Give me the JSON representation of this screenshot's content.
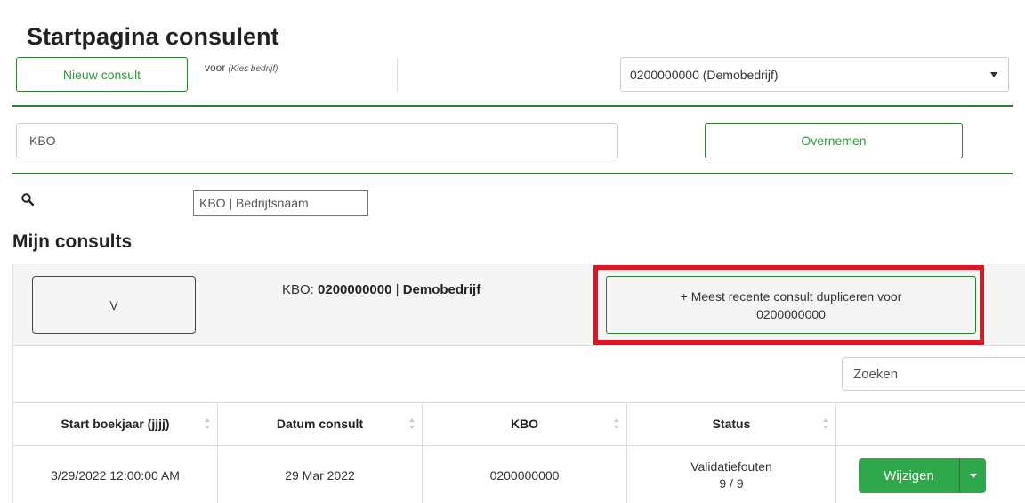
{
  "header": {
    "title": "Startpagina consulent",
    "new_consult_label": "Nieuw consult",
    "voor_label": "voor",
    "voor_hint": "(Kies bedrijf)",
    "selected_company": "0200000000 (Demobedrijf)"
  },
  "takeover": {
    "kbo_placeholder": "KBO",
    "overnemen_label": "Overnemen"
  },
  "search": {
    "icon": "search-icon",
    "placeholder": "KBO | Bedrijfsnaam"
  },
  "consults": {
    "title": "Mijn consults",
    "toggle_label": "V",
    "kbo_prefix": "KBO: ",
    "kbo_value": "0200000000",
    "separator": " | ",
    "company_name": "Demobedrijf",
    "duplicate_line1": "+ Meest recente consult dupliceren voor",
    "duplicate_line2": "0200000000",
    "highlight_color": "#e3141f",
    "table_search_placeholder": "Zoeken",
    "columns": [
      "Start boekjaar (jjjj)",
      "Datum consult",
      "KBO",
      "Status",
      ""
    ],
    "rows": [
      {
        "start_boekjaar": "3/29/2022 12:00:00 AM",
        "datum_consult": "29 Mar 2022",
        "kbo": "0200000000",
        "status_line1": "Validatiefouten",
        "status_line2": "9 / 9",
        "action_label": "Wijzigen"
      }
    ]
  },
  "colors": {
    "accent_green": "#2e7d32",
    "button_green": "#2ea84a"
  }
}
